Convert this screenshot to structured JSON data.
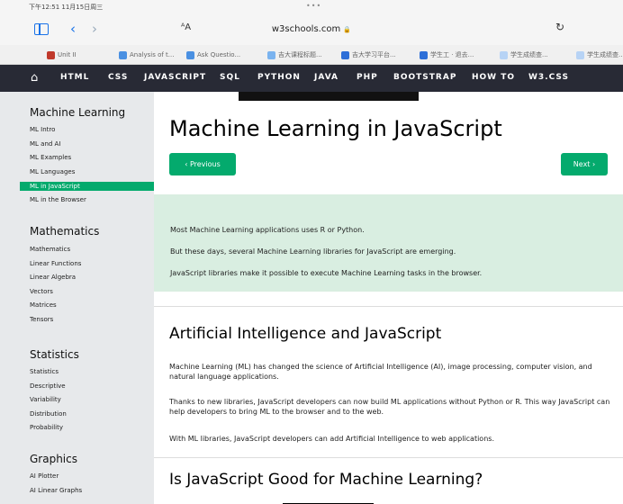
{
  "status": {
    "time": "下午12:51 11月15日周三",
    "dots": "•••"
  },
  "browser": {
    "url": "w3schools.com",
    "lock": "🔒",
    "reader": "ᴬA",
    "back": "‹",
    "forward": "›",
    "reload": "↻",
    "bookmarks": [
      {
        "label": "Unit II",
        "color": "#c0392b"
      },
      {
        "label": "Analysis of t...",
        "color": "#4a90e2"
      },
      {
        "label": "Ask Questio...",
        "color": "#4a90e2"
      },
      {
        "label": "吉大课程标题...",
        "color": "#7ab3ef"
      },
      {
        "label": "吉大学习平台...",
        "color": "#2d6fd8"
      },
      {
        "label": "学生工 · 退去...",
        "color": "#2d6fd8"
      },
      {
        "label": "学生成绩查...",
        "color": "#b7d3f5"
      },
      {
        "label": "学生成绩查...",
        "color": "#b7d3f5"
      }
    ]
  },
  "topnav": {
    "home_icon": "⌂",
    "links": [
      "HTML",
      "CSS",
      "JAVASCRIPT",
      "SQL",
      "PYTHON",
      "JAVA",
      "PHP",
      "BOOTSTRAP",
      "HOW TO",
      "W3.CSS"
    ]
  },
  "sidebar": {
    "sections": [
      {
        "heading": "Machine Learning",
        "items": [
          "ML Intro",
          "ML and AI",
          "ML Examples",
          "ML Languages",
          "ML in JavaScript",
          "ML in the Browser"
        ],
        "active": 4
      },
      {
        "heading": "Mathematics",
        "items": [
          "Mathematics",
          "Linear Functions",
          "Linear Algebra",
          "Vectors",
          "Matrices",
          "Tensors"
        ]
      },
      {
        "heading": "Statistics",
        "items": [
          "Statistics",
          "Descriptive",
          "Variability",
          "Distribution",
          "Probability"
        ]
      },
      {
        "heading": "Graphics",
        "items": [
          "AI Plotter",
          "AI Linear Graphs"
        ]
      }
    ]
  },
  "main": {
    "title": "Machine Learning in JavaScript",
    "prev_label": "‹ Previous",
    "next_label": "Next ›",
    "intro": [
      "Most Machine Learning applications uses R or Python.",
      "But these days, several Machine Learning libraries for JavaScript are emerging.",
      "JavaScript libraries make it possible to execute Machine Learning tasks in the browser."
    ],
    "section1_title": "Artificial Intelligence and JavaScript",
    "section1_paras": [
      "Machine Learning (ML) has changed the science of Artificial Intelligence (AI), image processing, computer vision, and natural language applications.",
      "Thanks to new libraries, JavaScript developers can now build ML applications without Python or R. This way JavaScript can help developers to bring ML to the browser and to the web.",
      "With ML libraries, JavaScript developers can add Artificial Intelligence to web applications."
    ],
    "section2_title": "Is JavaScript Good for Machine Learning?"
  },
  "colors": {
    "accent": "#04aa6d",
    "topnav_bg": "#282a35",
    "sidebar_bg": "#e7e9eb",
    "intro_bg": "#d9eee1"
  }
}
